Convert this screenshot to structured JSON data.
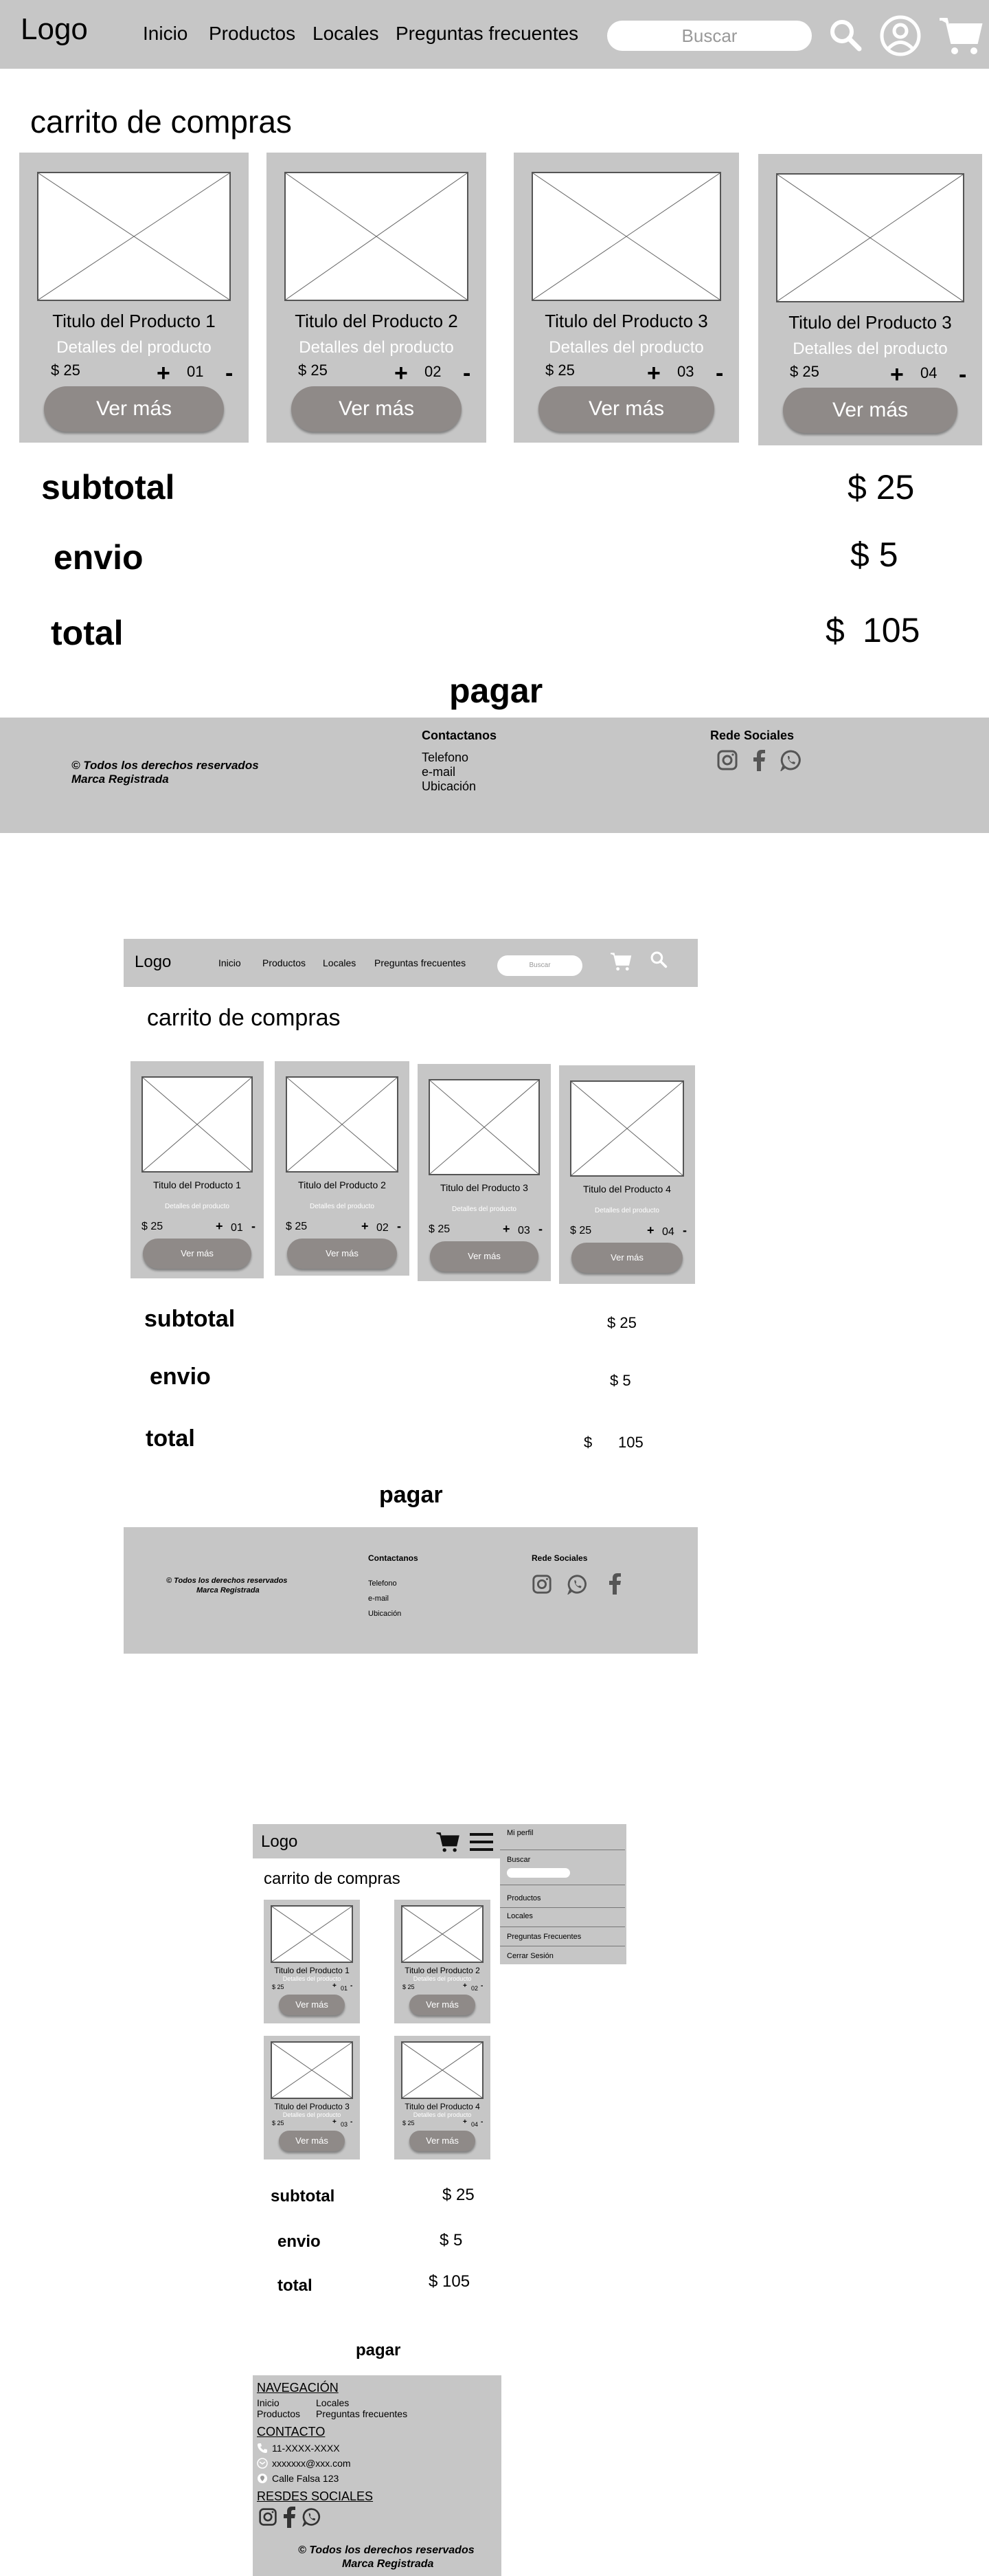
{
  "header": {
    "logo": "Logo",
    "nav": [
      "Inicio",
      "Productos",
      "Locales",
      "Preguntas frecuentes"
    ],
    "search_placeholder": "Buscar"
  },
  "cart": {
    "title": "carrito de compras",
    "products": [
      {
        "title": "Titulo del Producto 1",
        "details": "Detalles del producto",
        "price": "$ 25",
        "qty": "01",
        "button": "Ver más"
      },
      {
        "title": "Titulo del Producto 2",
        "details": "Detalles del producto",
        "price": "$ 25",
        "qty": "02",
        "button": "Ver más"
      },
      {
        "title": "Titulo del Producto 3",
        "details": "Detalles del producto",
        "price": "$ 25",
        "qty": "03",
        "button": "Ver más"
      },
      {
        "title": "Titulo del Producto 3",
        "details": "Detalles del producto",
        "price": "$ 25",
        "qty": "04",
        "button": "Ver más"
      }
    ],
    "products_tablet": [
      {
        "title": "Titulo del Producto 1",
        "details": "Detalles del producto",
        "price": "$ 25",
        "qty": "01",
        "button": "Ver más"
      },
      {
        "title": "Titulo del Producto 2",
        "details": "Detalles del producto",
        "price": "$ 25",
        "qty": "02",
        "button": "Ver más"
      },
      {
        "title": "Titulo del Producto 3",
        "details": "Detalles del producto",
        "price": "$ 25",
        "qty": "03",
        "button": "Ver más"
      },
      {
        "title": "Titulo del Producto 4",
        "details": "Detalles del producto",
        "price": "$ 25",
        "qty": "04",
        "button": "Ver más"
      }
    ],
    "plus": "+",
    "minus": "-",
    "subtotal_label": "subtotal",
    "subtotal_value": "$ 25",
    "envio_label": "envio",
    "envio_value": "$ 5",
    "total_label": "total",
    "total_value": "$ 105",
    "total_currency": "$",
    "total_amount": "105",
    "pay": "pagar"
  },
  "footer": {
    "rights_line1": "© Todos los derechos reservados",
    "rights_line2": "Marca Registrada",
    "contact_title": "Contactanos",
    "contact_items": [
      "Telefono",
      "e-mail",
      "Ubicación"
    ],
    "social_title": "Rede Sociales"
  },
  "mobile": {
    "menu": {
      "profile": "Mi perfil",
      "search": "Buscar",
      "items": [
        "Productos",
        "Locales",
        "Preguntas Frecuentes",
        "Cerrar Sesión"
      ]
    },
    "footer": {
      "nav_title": "NAVEGACIÓN",
      "nav_col1": [
        "Inicio",
        "Productos"
      ],
      "nav_col2": [
        "Locales",
        "Preguntas frecuentes"
      ],
      "contact_title": "CONTACTO",
      "phone": "11-XXXX-XXXX",
      "email": "xxxxxxx@xxx.com",
      "address": "Calle Falsa 123",
      "social_title": "RESDES SOCIALES",
      "rights_line1": "© Todos los derechos reservados",
      "rights_line2": "Marca Registrada"
    }
  },
  "colors": {
    "panel": "#c6c6c6",
    "button": "#8f8a88",
    "background": "#ffffff"
  }
}
